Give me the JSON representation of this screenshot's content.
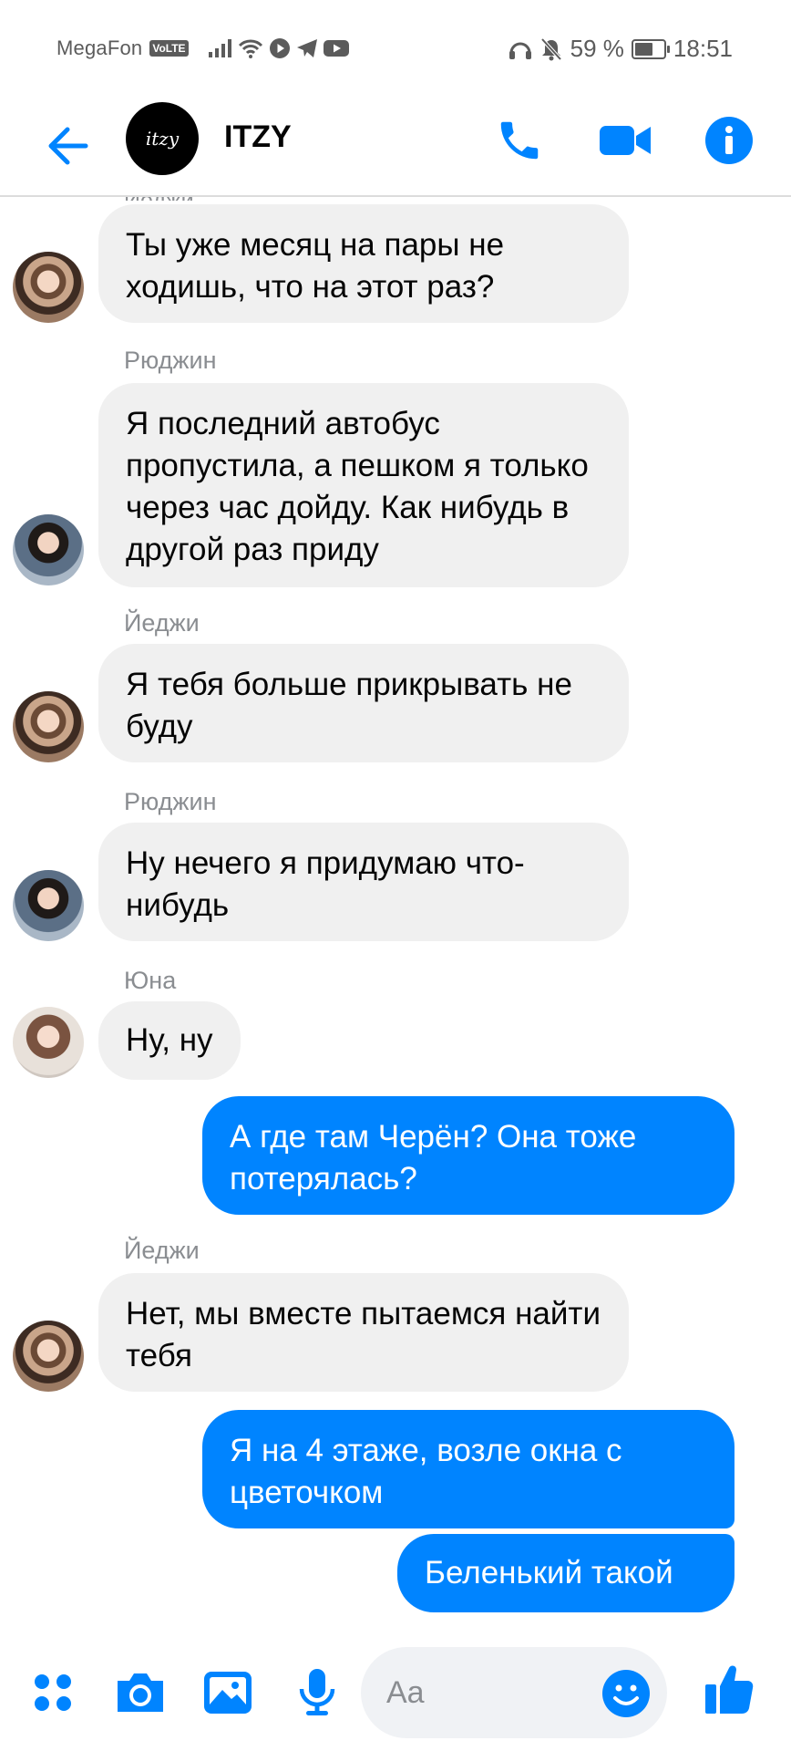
{
  "status_bar": {
    "carrier": "MegaFon",
    "volte": "VoLTE",
    "battery": "59 %",
    "battery_level": 0.59,
    "time": "18:51"
  },
  "header": {
    "avatar_text": "itzy",
    "title": "ITZY",
    "icons": [
      "back-arrow-icon",
      "phone-icon",
      "video-icon",
      "info-icon"
    ]
  },
  "messages": [
    {
      "sender": "",
      "text": "Ты уже месяц на пары не ходишь, что на этот раз?",
      "direction": "incoming"
    },
    {
      "sender": "Рюджин",
      "text": "Я последний автобус пропустила, а пешком я только через час дойду. Как нибудь в другой раз приду",
      "direction": "incoming"
    },
    {
      "sender": "Йеджи",
      "text": "Я тебя больше прикрывать не буду",
      "direction": "incoming"
    },
    {
      "sender": "Рюджин",
      "text": "Ну нечего я придумаю что-нибудь",
      "direction": "incoming"
    },
    {
      "sender": "Юна",
      "text": "Ну, ну",
      "direction": "incoming"
    },
    {
      "sender": "",
      "text": "А где там Черён? Она тоже потерялась?",
      "direction": "outgoing"
    },
    {
      "sender": "Йеджи",
      "text": "Нет, мы вместе пытаемся найти тебя",
      "direction": "incoming"
    },
    {
      "sender": "",
      "text": "Я на 4 этаже, возле окна с цветочком",
      "direction": "outgoing"
    },
    {
      "sender": "",
      "text": "Беленький такой",
      "direction": "outgoing"
    }
  ],
  "composer": {
    "placeholder": "Aa",
    "icons": [
      "apps-icon",
      "camera-icon",
      "gallery-icon",
      "microphone-icon",
      "emoji-icon",
      "thumbs-up-icon"
    ]
  },
  "colors": {
    "accent": "#0084ff",
    "incoming_bubble": "#f0f0f0",
    "secondary_text": "#8a8d91"
  }
}
